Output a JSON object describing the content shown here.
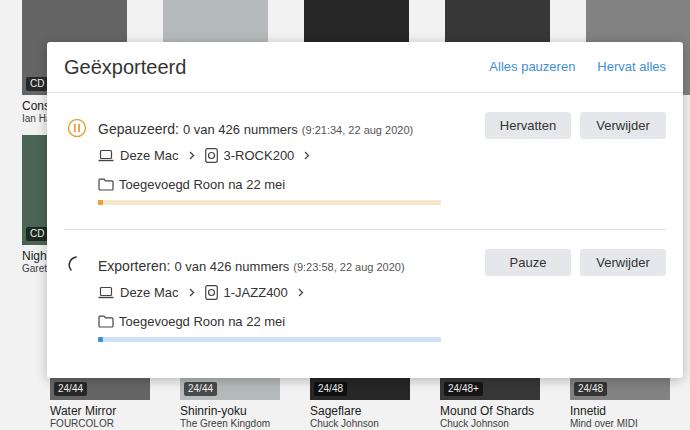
{
  "library": {
    "rows": [
      [
        {
          "title": "Cons",
          "artist": "Ian Ha",
          "badge": "CD"
        },
        {},
        {},
        {},
        {}
      ],
      [
        {
          "title": "Nigh",
          "artist": "Garet",
          "badge": "CD"
        }
      ],
      [
        {
          "title": "Water Mirror",
          "artist": "FOURCOLOR",
          "badge": "24/44"
        },
        {
          "title": "Shinrin-yoku",
          "artist": "The Green Kingdom",
          "badge": "24/44"
        },
        {
          "title": "Sageflare",
          "artist": "Chuck Johnson",
          "badge": "24/48"
        },
        {
          "title": "Mound Of Shards",
          "artist": "Chuck Johnson",
          "badge": "24/48+"
        },
        {
          "title": "Innetid",
          "artist": "Mind over MIDI",
          "badge": "24/48"
        }
      ]
    ]
  },
  "dialog": {
    "title": "Geëxporteerd",
    "actions": [
      "Alles pauzeren",
      "Hervat alles"
    ],
    "exports": [
      {
        "kind": "paused",
        "status": "Gepauzeerd:",
        "count": "0 van 426 nummers",
        "time": "(9:21:34, 22 aug 2020)",
        "source": "Deze Mac",
        "device": "3-ROCK200",
        "folder": "Toegevoegd Roon na 22 mei",
        "level": 0.015,
        "buttons": [
          "Hervatten",
          "Verwijder"
        ]
      },
      {
        "kind": "exporting",
        "status": "Exporteren:",
        "count": "0 van 426 nummers",
        "time": "(9:23:58, 22 aug 2020)",
        "source": "Deze Mac",
        "device": "1-JAZZ400",
        "folder": "Toegevoegd Roon na 22 mei",
        "level": 0.015,
        "buttons": [
          "Pauze",
          "Verwijder"
        ]
      }
    ]
  }
}
